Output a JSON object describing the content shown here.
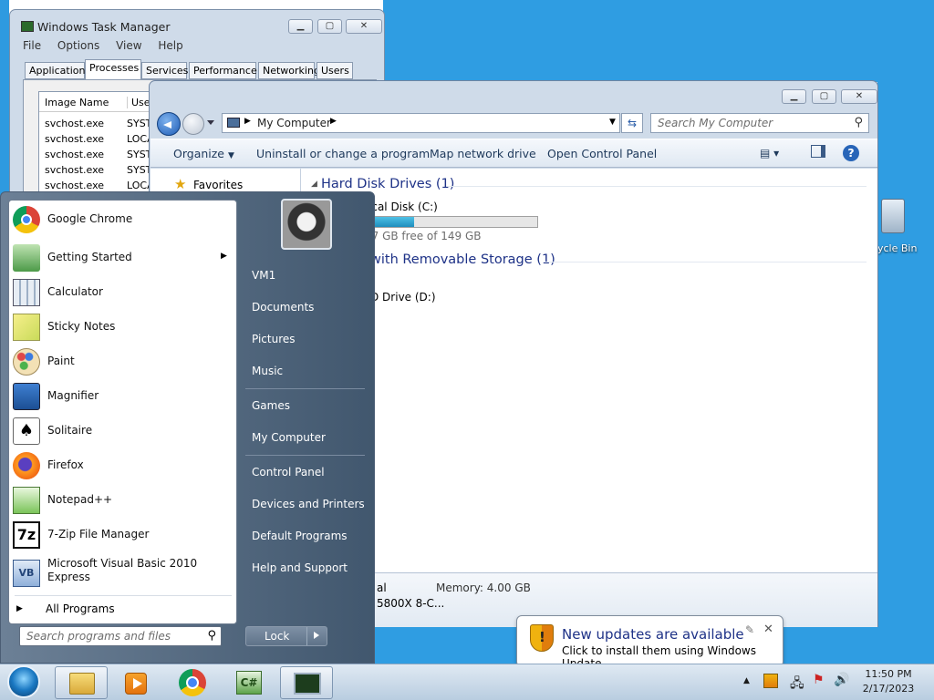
{
  "task_manager": {
    "title": "Windows Task Manager",
    "menu": [
      "File",
      "Options",
      "View",
      "Help"
    ],
    "tabs": [
      "Applications",
      "Processes",
      "Services",
      "Performance",
      "Networking",
      "Users"
    ],
    "active_tab": "Processes",
    "columns": [
      "Image Name",
      "User"
    ],
    "rows": [
      {
        "name": "svchost.exe",
        "user": "SYST"
      },
      {
        "name": "svchost.exe",
        "user": "LOCA"
      },
      {
        "name": "svchost.exe",
        "user": "SYST"
      },
      {
        "name": "svchost.exe",
        "user": "SYST"
      },
      {
        "name": "svchost.exe",
        "user": "LOCA"
      }
    ]
  },
  "explorer": {
    "breadcrumb": "My Computer",
    "search_placeholder": "Search My Computer",
    "commands": [
      "Organize",
      "Uninstall or change a program",
      "Map network drive",
      "Open Control Panel"
    ],
    "sidebar": {
      "favorites": "Favorites"
    },
    "groups": [
      {
        "title": "Hard Disk Drives (1)"
      },
      {
        "title": "with Removable Storage (1)"
      }
    ],
    "drives": [
      {
        "name": "ocal Disk (C:)",
        "free_text": "07 GB free of 149 GB",
        "used_fraction": 0.28
      },
      {
        "name": "D Drive (D:)"
      }
    ],
    "details": {
      "line1": "al",
      "memory": "Memory: 4.00 GB",
      "line2": "5800X 8-C..."
    }
  },
  "desktop": {
    "recycle_bin": "ycle Bin"
  },
  "start_menu": {
    "pinned": [
      {
        "label": "Google Chrome",
        "icon": "chrome-icon"
      },
      {
        "label": "Getting Started",
        "icon": "getting-started-icon",
        "submenu": true
      },
      {
        "label": "Calculator",
        "icon": "calculator-icon"
      },
      {
        "label": "Sticky Notes",
        "icon": "sticky-notes-icon"
      },
      {
        "label": "Paint",
        "icon": "paint-icon"
      },
      {
        "label": "Magnifier",
        "icon": "magnifier-icon"
      },
      {
        "label": "Solitaire",
        "icon": "solitaire-icon"
      },
      {
        "label": "Firefox",
        "icon": "firefox-icon"
      },
      {
        "label": "Notepad++",
        "icon": "notepadpp-icon"
      },
      {
        "label": "7-Zip File Manager",
        "icon": "7zip-icon"
      },
      {
        "label": "Microsoft Visual Basic 2010",
        "label2": "Express",
        "icon": "vb-icon"
      }
    ],
    "all_programs": "All Programs",
    "search_placeholder": "Search programs and files",
    "right_items": [
      "VM1",
      "Documents",
      "Pictures",
      "Music",
      "Games",
      "My Computer",
      "Control Panel",
      "Devices and Printers",
      "Default Programs",
      "Help and Support"
    ],
    "lock_label": "Lock"
  },
  "notification": {
    "title": "New updates are available",
    "body": "Click to install them using Windows Update."
  },
  "taskbar": {
    "time": "11:50 PM",
    "date": "2/17/2023",
    "apps": [
      "explorer-icon",
      "media-player-icon",
      "chrome-icon",
      "csharp-icon",
      "task-manager-icon"
    ]
  },
  "colors": {
    "desktop": "#2f9de2",
    "link_blue": "#1e3287",
    "progress": "#26a0da"
  }
}
